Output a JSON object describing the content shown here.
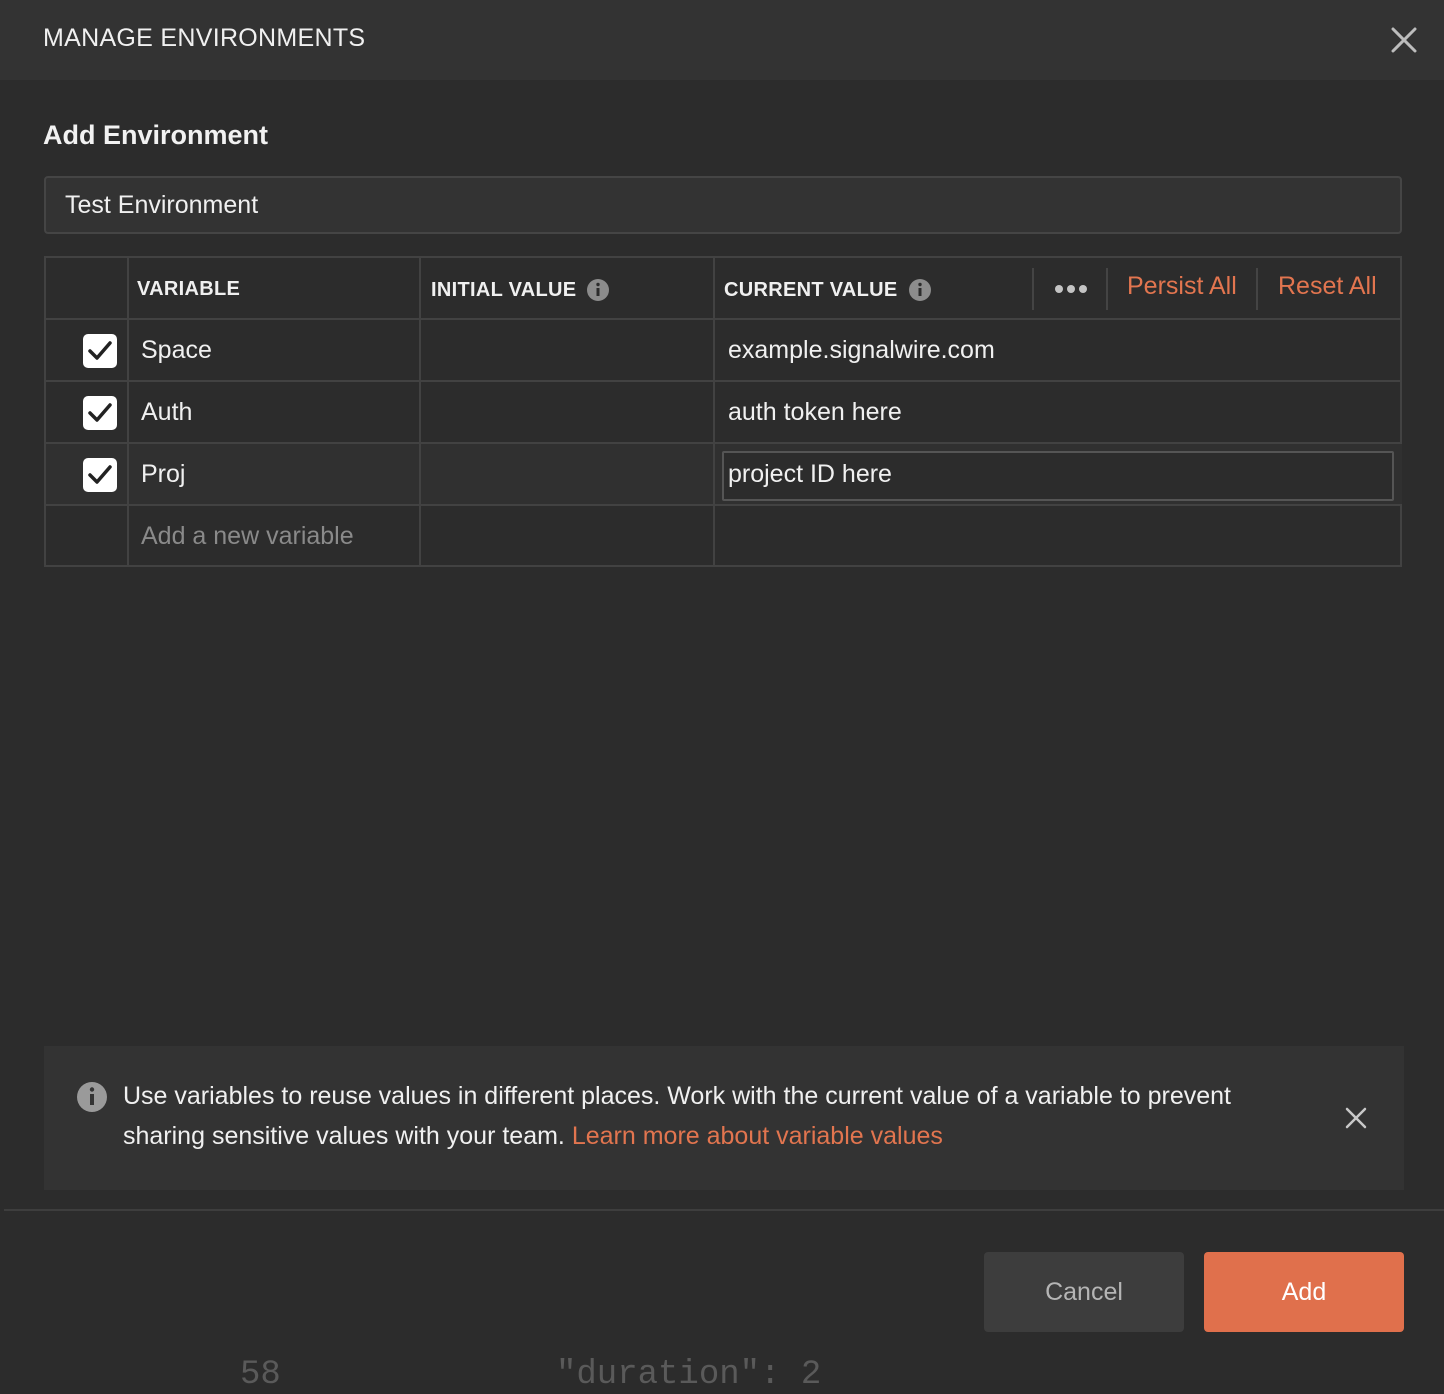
{
  "dialog": {
    "title": "MANAGE ENVIRONMENTS",
    "close_icon": "close-icon"
  },
  "form": {
    "heading": "Add Environment",
    "environment_name": "Test Environment"
  },
  "table": {
    "headers": {
      "variable": "VARIABLE",
      "initial_value": "INITIAL VALUE",
      "current_value": "CURRENT VALUE"
    },
    "actions": {
      "more_icon": "more-horizontal-icon",
      "persist_all": "Persist All",
      "reset_all": "Reset All"
    },
    "rows": [
      {
        "enabled": true,
        "variable": "Space",
        "initial_value": "",
        "current_value": "example.signalwire.com"
      },
      {
        "enabled": true,
        "variable": "Auth",
        "initial_value": "",
        "current_value": "auth token here"
      },
      {
        "enabled": true,
        "variable": "Proj",
        "initial_value": "",
        "current_value": "project ID here"
      }
    ],
    "new_variable_placeholder": "Add a new variable"
  },
  "banner": {
    "icon": "info-icon",
    "text": "Use variables to reuse values in different places. Work with the current value of a variable to prevent sharing sensitive values with your team.",
    "link": "Learn more about variable values"
  },
  "footer": {
    "cancel_label": "Cancel",
    "add_label": "Add"
  },
  "background_peek": {
    "left_text": "58",
    "right_text": "\"duration\": 2"
  },
  "colors": {
    "accent": "#e0704c",
    "link": "#e2754f",
    "dialog_bg": "#2c2c2c",
    "header_bg": "#333333"
  }
}
